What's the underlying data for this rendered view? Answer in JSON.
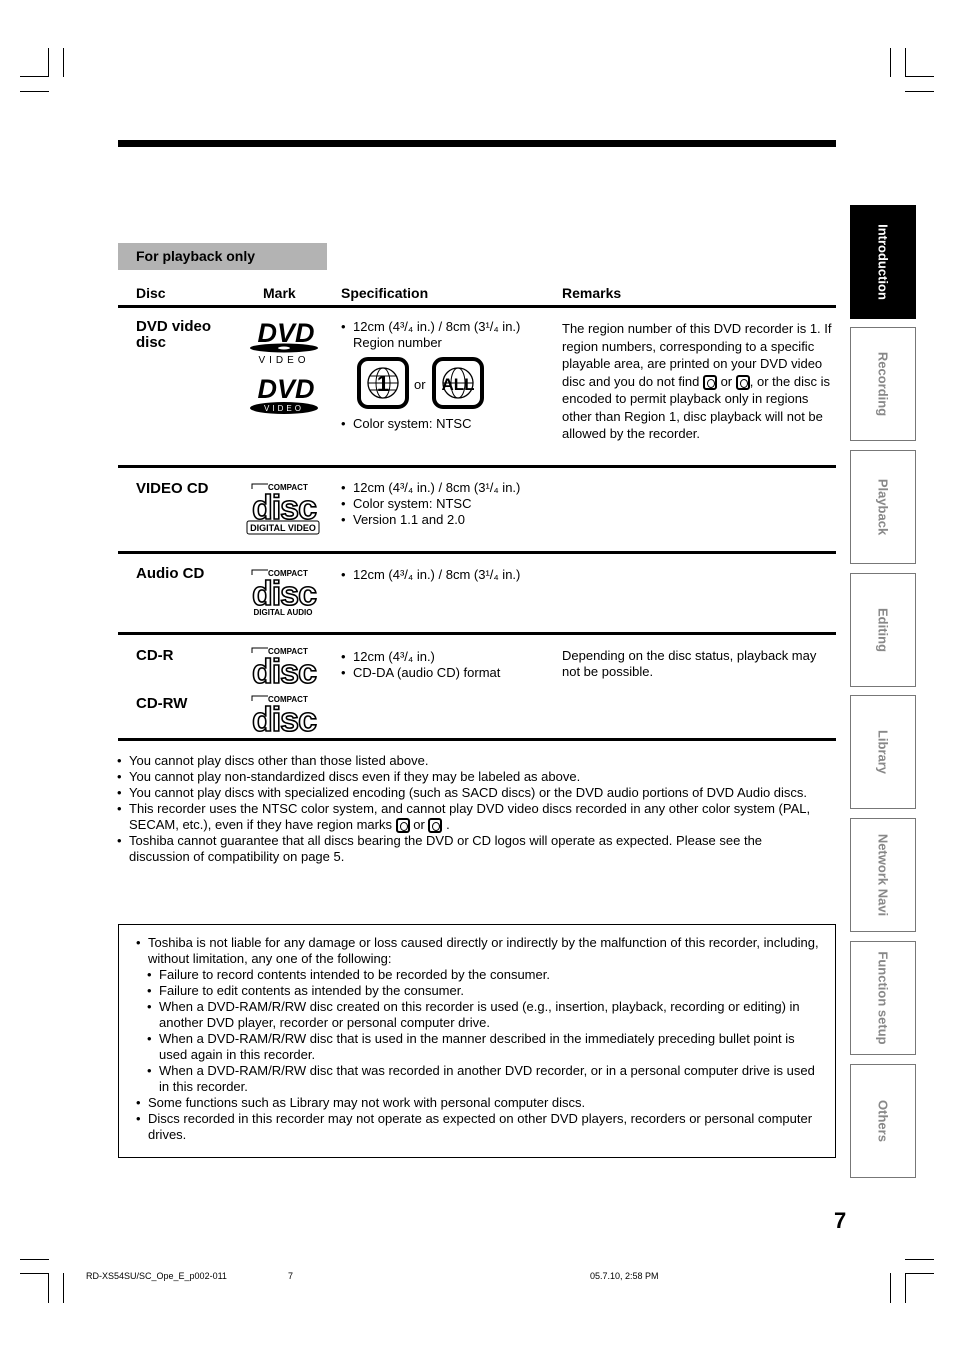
{
  "section_band": "For playback only",
  "table": {
    "headers": {
      "disc": "Disc",
      "mark": "Mark",
      "spec": "Specification",
      "remarks": "Remarks"
    },
    "rows": [
      {
        "disc": "DVD video disc",
        "marks": [
          "dvd-video-logo",
          "dvd-video-logo-alt"
        ],
        "spec": [
          "12cm (4³/₄ in.) / 8cm (3¹/₄ in.)",
          "Region number",
          "Color system: NTSC"
        ],
        "region_labels": {
          "one": "1",
          "or": "or",
          "all": "ALL"
        },
        "remarks_parts": [
          "The region number of this DVD recorder is 1. If region numbers, corresponding to a specific playable area, are printed on your DVD video disc and you do not find",
          "or",
          ", or the disc is encoded to permit playback only in regions other than Region 1, disc playback will not be allowed by the recorder."
        ]
      },
      {
        "disc": "VIDEO CD",
        "marks": [
          "compact-disc-digital-video-logo"
        ],
        "logo_caption": "DIGITAL VIDEO",
        "spec": [
          "12cm (4³/₄ in.) / 8cm (3¹/₄ in.)",
          "Color system: NTSC",
          "Version 1.1 and 2.0"
        ],
        "remarks": ""
      },
      {
        "disc": "Audio CD",
        "marks": [
          "compact-disc-digital-audio-logo"
        ],
        "logo_caption": "DIGITAL AUDIO",
        "spec": [
          "12cm (4³/₄ in.) / 8cm (3¹/₄ in.)"
        ],
        "remarks": ""
      },
      {
        "disc": "CD-R",
        "disc2": "CD-RW",
        "marks": [
          "compact-disc-logo",
          "compact-disc-logo"
        ],
        "spec": [
          "12cm (4³/₄ in.)",
          "CD-DA (audio CD) format"
        ],
        "remarks": "Depending on the disc status, playback may not be possible."
      }
    ],
    "logo_text": {
      "compact": "COMPACT",
      "disc": "disc",
      "dvd": "DVD",
      "video": "VIDEO"
    }
  },
  "notes": [
    "You cannot play discs other than those listed above.",
    "You cannot play non-standardized discs even if they may be labeled as above.",
    "You cannot play discs with specialized encoding (such as SACD discs) or the DVD audio portions of DVD Audio discs.",
    {
      "before": "This recorder uses the NTSC color system, and cannot play DVD video discs recorded in any other color system (PAL, SECAM, etc.), even if they have region marks",
      "or": "or",
      "after": "."
    },
    "Toshiba cannot guarantee that all discs bearing the DVD or CD logos will operate as expected.  Please see the discussion of compatibility on page 5."
  ],
  "disclaimer": {
    "items": [
      "Toshiba is not liable for any damage or loss caused directly or indirectly by the malfunction of this recorder, including, without limitation, any one of the following:",
      "Some functions such as Library may not work with personal computer discs.",
      "Discs recorded in this recorder may not operate as expected on other DVD players, recorders or personal computer drives."
    ],
    "sub_items": [
      "Failure to record contents intended to be recorded by the consumer.",
      "Failure to edit contents as intended by the consumer.",
      "When a DVD-RAM/R/RW disc created on this recorder is used (e.g., insertion, playback, recording or editing) in another DVD player, recorder or personal computer drive.",
      "When a DVD-RAM/R/RW disc that is used in the manner described in the immediately preceding bullet point is used again in this recorder.",
      "When a DVD-RAM/R/RW disc that was recorded in another DVD recorder, or in a personal computer drive is used in this recorder."
    ]
  },
  "side_tabs": [
    {
      "label": "Introduction",
      "active": true
    },
    {
      "label": "Recording",
      "active": false
    },
    {
      "label": "Playback",
      "active": false
    },
    {
      "label": "Editing",
      "active": false
    },
    {
      "label": "Library",
      "active": false
    },
    {
      "label": "Network Navi",
      "active": false
    },
    {
      "label": "Function setup",
      "active": false
    },
    {
      "label": "Others",
      "active": false
    }
  ],
  "page_number": "7",
  "footer": {
    "file": "RD-XS54SU/SC_Ope_E_p002-011",
    "page": "7",
    "timestamp": "05.7.10, 2:58 PM"
  }
}
